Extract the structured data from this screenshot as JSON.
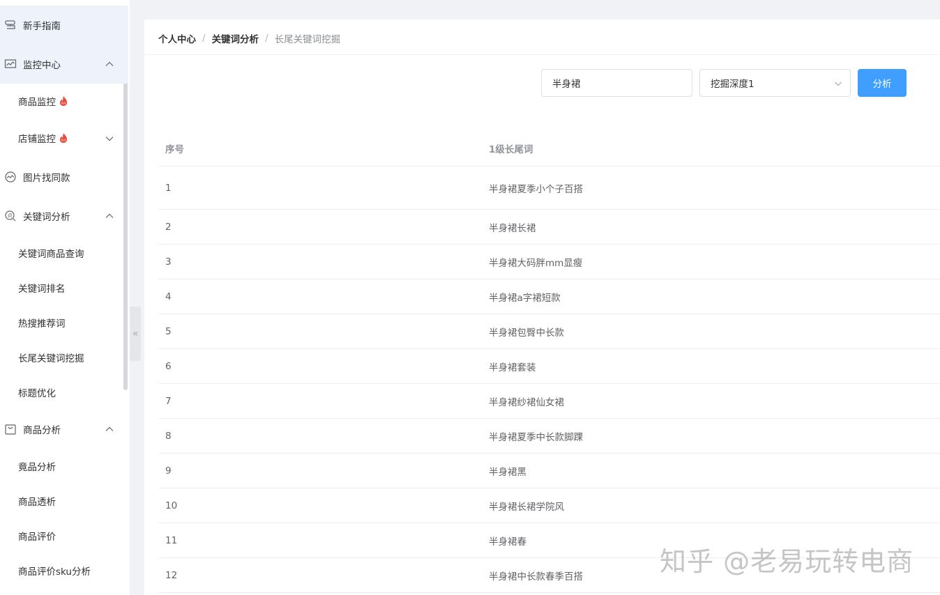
{
  "sidebar": {
    "items": [
      {
        "label": "新手指南",
        "icon": "guide-icon"
      },
      {
        "label": "监控中心",
        "icon": "monitor-icon",
        "expanded": true
      },
      {
        "label": "商品监控",
        "hot": true
      },
      {
        "label": "店铺监控",
        "hot": true
      },
      {
        "label": "图片找同款",
        "icon": "image-search-icon"
      },
      {
        "label": "关键词分析",
        "icon": "keyword-icon",
        "expanded": true
      },
      {
        "label": "关键词商品查询"
      },
      {
        "label": "关键词排名"
      },
      {
        "label": "热搜推荐词"
      },
      {
        "label": "长尾关键词挖掘"
      },
      {
        "label": "标题优化"
      },
      {
        "label": "商品分析",
        "icon": "bag-icon",
        "expanded": true
      },
      {
        "label": "竟品分析"
      },
      {
        "label": "商品透析"
      },
      {
        "label": "商品评价"
      },
      {
        "label": "商品评价sku分析"
      }
    ],
    "collapse_glyph": "«"
  },
  "breadcrumb": {
    "level1": "个人中心",
    "level2": "关键词分析",
    "level3": "长尾关键词挖掘",
    "separator": "/"
  },
  "search": {
    "value": "半身裙"
  },
  "depth_select": {
    "value": "挖掘深度1"
  },
  "analyze_button": "分析",
  "table": {
    "headers": {
      "index": "序号",
      "keyword": "1级长尾词"
    },
    "rows": [
      {
        "index": "1",
        "keyword": "半身裙夏季小个子百搭"
      },
      {
        "index": "2",
        "keyword": "半身裙长裙"
      },
      {
        "index": "3",
        "keyword": "半身裙大码胖mm显瘦"
      },
      {
        "index": "4",
        "keyword": "半身裙a字裙短款"
      },
      {
        "index": "5",
        "keyword": "半身裙包臀中长款"
      },
      {
        "index": "6",
        "keyword": "半身裙套装"
      },
      {
        "index": "7",
        "keyword": "半身裙纱裙仙女裙"
      },
      {
        "index": "8",
        "keyword": "半身裙夏季中长款脚踝"
      },
      {
        "index": "9",
        "keyword": "半身裙黑"
      },
      {
        "index": "10",
        "keyword": "半身裙长裙学院风"
      },
      {
        "index": "11",
        "keyword": "半身裙春"
      },
      {
        "index": "12",
        "keyword": "半身裙中长款春季百搭"
      }
    ]
  },
  "watermark": "知乎 @老易玩转电商",
  "colors": {
    "primary": "#409eff",
    "hot": "#e84a3b",
    "active_bg": "#eef3fb"
  }
}
